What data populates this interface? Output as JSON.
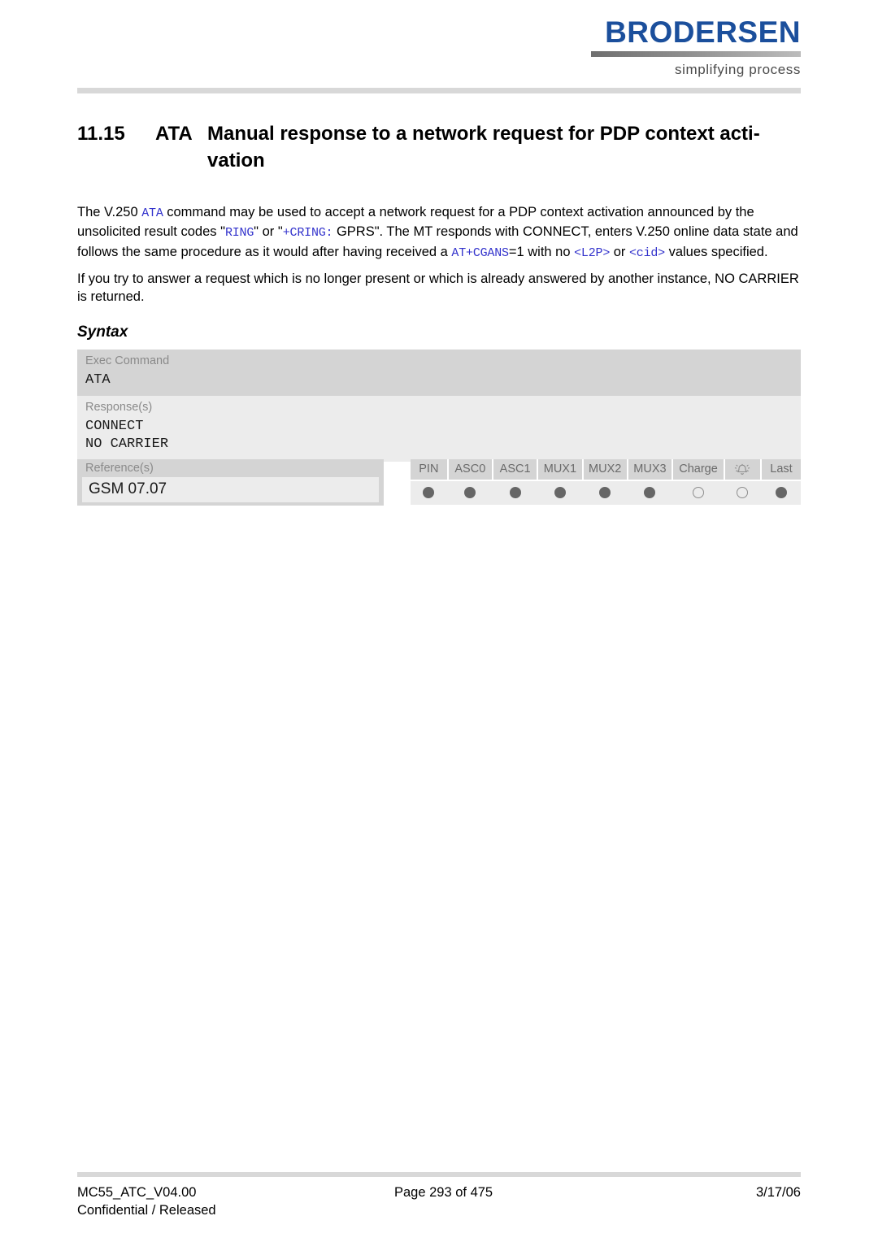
{
  "header": {
    "logo_word": "BRODERSEN",
    "logo_tagline": "simplifying process"
  },
  "section": {
    "number": "11.15",
    "command": "ATA",
    "title": "Manual response to a network request for PDP context acti-",
    "title_line2": "vation"
  },
  "body": {
    "p1_seg1": "The V.250 ",
    "p1_code1": "ATA",
    "p1_seg2": " command may be used to accept a network request for a PDP context activation announced by the unsolicited result codes \"",
    "p1_code2": "RING",
    "p1_seg3": "\" or \"",
    "p1_code3": "+CRING:",
    "p1_seg4": " GPRS\". The MT responds with CONNECT, enters V.250 online data state and follows the same procedure as it would after having received a ",
    "p1_code4": "AT+CGANS",
    "p1_seg5": "=1 with no ",
    "p1_code5": "<L2P>",
    "p1_seg6": " or ",
    "p1_code6": "<cid>",
    "p1_seg7": " values specified.",
    "p2": "If you try to answer a request which is no longer present or which is already answered by another instance, NO CARRIER is returned."
  },
  "syntax": {
    "label": "Syntax",
    "exec_label": "Exec Command",
    "exec_code": "ATA",
    "response_label": "Response(s)",
    "response_code": "CONNECT\nNO CARRIER",
    "reference_label": "Reference(s)",
    "reference_value": "GSM 07.07"
  },
  "indicators": {
    "columns": [
      {
        "label": "PIN",
        "state": "filled",
        "icon": ""
      },
      {
        "label": "ASC0",
        "state": "filled",
        "icon": ""
      },
      {
        "label": "ASC1",
        "state": "filled",
        "icon": ""
      },
      {
        "label": "MUX1",
        "state": "filled",
        "icon": ""
      },
      {
        "label": "MUX2",
        "state": "filled",
        "icon": ""
      },
      {
        "label": "MUX3",
        "state": "filled",
        "icon": ""
      },
      {
        "label": "Charge",
        "state": "hollow",
        "icon": ""
      },
      {
        "label": "",
        "state": "hollow",
        "icon": "alarm-bell-icon"
      },
      {
        "label": "Last",
        "state": "filled",
        "icon": ""
      }
    ]
  },
  "footer": {
    "doc_id": "MC55_ATC_V04.00",
    "classification": "Confidential / Released",
    "page_label": "Page 293 of 475",
    "date": "3/17/06"
  },
  "colors": {
    "brand_blue": "#1b4f9c",
    "code_blue": "#3333cc",
    "band_dark": "#d4d4d4",
    "band_light": "#ececec"
  }
}
